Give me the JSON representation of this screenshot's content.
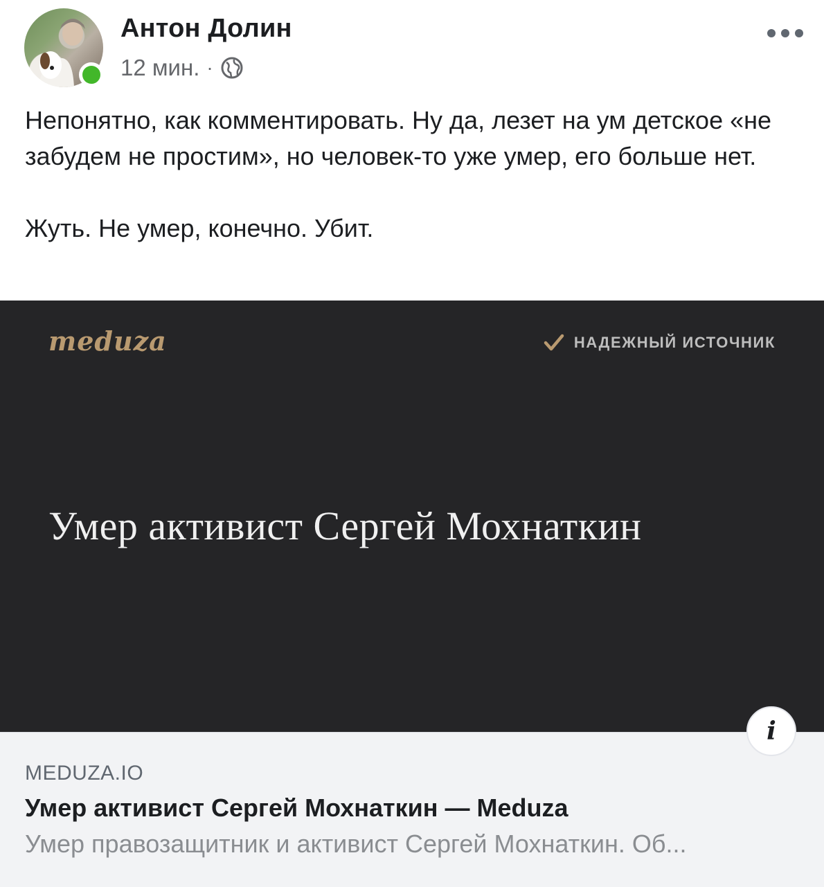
{
  "post": {
    "author_name": "Антон Долин",
    "time": "12 мин.",
    "separator": "·",
    "privacy_icon": "globe-icon",
    "more_icon": "more-options-icon",
    "paragraphs": [
      "Непонятно, как комментировать. Ну да, лезет на ум детское «не забудем не простим», но человек-то уже умер, его больше нет.",
      "Жуть. Не умер, конечно. Убит."
    ]
  },
  "link_preview": {
    "image": {
      "logo": "meduza",
      "badge_icon": "check-icon",
      "badge_label": "НАДЕЖНЫЙ ИСТОЧНИК",
      "headline": "Умер активист Сергей Мохнаткин"
    },
    "info_icon": "i",
    "domain": "MEDUZA.IO",
    "title": "Умер активист Сергей Мохнаткин — Meduza",
    "description": "Умер правозащитник и активист Сергей Мохнаткин. Об..."
  },
  "colors": {
    "online": "#42b72a",
    "preview_bg": "#252527",
    "logo": "#b99a70",
    "caption_bg": "#f2f3f5"
  }
}
